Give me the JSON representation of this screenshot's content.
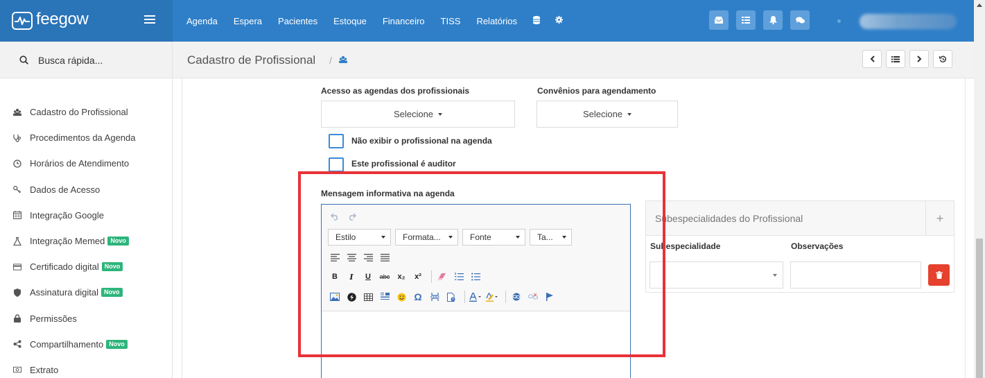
{
  "app": {
    "logo_text": "feegow",
    "brand_color": "#2f7fc8",
    "accent_color": "#2db57b",
    "highlight_color": "#e83238"
  },
  "topnav": {
    "items": [
      "Agenda",
      "Espera",
      "Pacientes",
      "Estoque",
      "Financeiro",
      "TISS",
      "Relatórios"
    ],
    "icons": [
      "database-icon",
      "gear-icon"
    ],
    "buttons": [
      "inbox-icon",
      "list-icon",
      "bell-icon",
      "chat-icon"
    ]
  },
  "search": {
    "placeholder": "Busca rápida..."
  },
  "sidebar": {
    "items": [
      {
        "label": "Cadastro do Profissional",
        "icon": "user-group-icon",
        "badge": ""
      },
      {
        "label": "Procedimentos da Agenda",
        "icon": "stethoscope-icon",
        "badge": ""
      },
      {
        "label": "Horários de Atendimento",
        "icon": "clock-icon",
        "badge": ""
      },
      {
        "label": "Dados de Acesso",
        "icon": "key-icon",
        "badge": ""
      },
      {
        "label": "Integração Google",
        "icon": "calendar-icon",
        "badge": ""
      },
      {
        "label": "Integração Memed",
        "icon": "flask-icon",
        "badge": "Novo"
      },
      {
        "label": "Certificado digital",
        "icon": "card-icon",
        "badge": "Novo"
      },
      {
        "label": "Assinatura digital",
        "icon": "shield-icon",
        "badge": "Novo"
      },
      {
        "label": "Permissões",
        "icon": "lock-icon",
        "badge": ""
      },
      {
        "label": "Compartilhamento",
        "icon": "share-icon",
        "badge": "Novo"
      },
      {
        "label": "Extrato",
        "icon": "money-icon",
        "badge": ""
      }
    ]
  },
  "breadcrumb": {
    "title": "Cadastro de Profissional",
    "separator": "/"
  },
  "form": {
    "acesso_label": "Acesso as agendas dos profissionais",
    "acesso_value": "Selecione",
    "convenios_label": "Convênios para agendamento",
    "convenios_value": "Selecione",
    "checkbox_1": "Não exibir o profissional na agenda",
    "checkbox_2": "Este profissional é auditor",
    "mensagem_label": "Mensagem informativa na agenda"
  },
  "editor": {
    "dropdowns": [
      "Estilo",
      "Formata...",
      "Fonte",
      "Ta..."
    ],
    "buttons": {
      "bold": "B",
      "italic": "I",
      "underline": "U",
      "strike": "abc",
      "subscript": "x₂",
      "superscript": "x²",
      "omega": "Ω"
    }
  },
  "subespecialidades": {
    "title": "Subespecialidades do Profissional",
    "add": "+",
    "col_subespecialidade": "Subespecialidade",
    "col_observacoes": "Observações"
  }
}
